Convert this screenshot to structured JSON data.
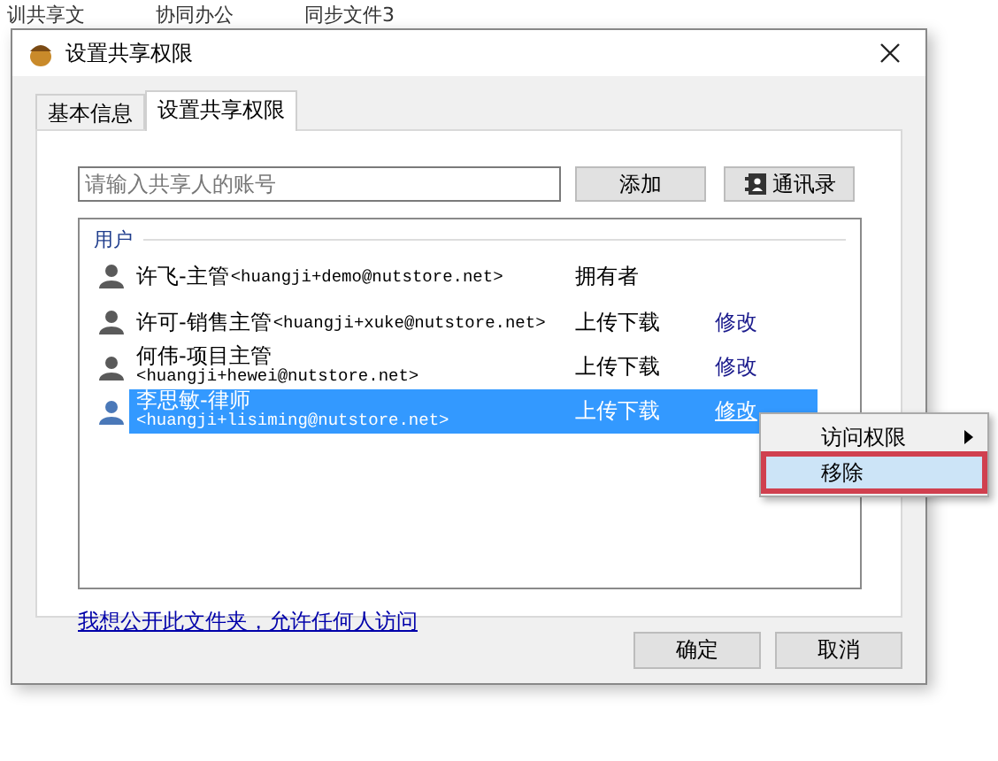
{
  "background_tabs": [
    "训共享文",
    "协同办公",
    "同步文件3"
  ],
  "window": {
    "title": "设置共享权限"
  },
  "tabs": [
    {
      "label": "基本信息",
      "selected": false
    },
    {
      "label": "设置共享权限",
      "selected": true
    }
  ],
  "account_field": {
    "placeholder": "请输入共享人的账号"
  },
  "add_button": "添加",
  "contacts_button": "通讯录",
  "user_list": {
    "group": "用户",
    "rows": [
      {
        "kind": "inline",
        "name": "许飞-主管",
        "email": "<huangji+demo@nutstore.net>",
        "permission": "拥有者",
        "selected": false
      },
      {
        "kind": "inline",
        "name": "许可-销售主管",
        "email": "<huangji+xuke@nutstore.net>",
        "permission": "上传下载",
        "action": "修改",
        "selected": false
      },
      {
        "kind": "stacked",
        "name": "何伟-项目主管",
        "email": "<huangji+hewei@nutstore.net>",
        "permission": "上传下载",
        "action": "修改",
        "selected": false
      },
      {
        "kind": "stacked",
        "name": "李思敏-律师",
        "email": "<huangji+lisiming@nutstore.net>",
        "permission": "上传下载",
        "action": "修改",
        "selected": true
      }
    ]
  },
  "context_menu": [
    {
      "label": "访问权限",
      "submenu": true,
      "selected": false
    },
    {
      "label": "移除",
      "submenu": false,
      "selected": true
    }
  ],
  "public_link": "我想公开此文件夹，允许任何人访问",
  "buttons": [
    "确定",
    "取消"
  ]
}
